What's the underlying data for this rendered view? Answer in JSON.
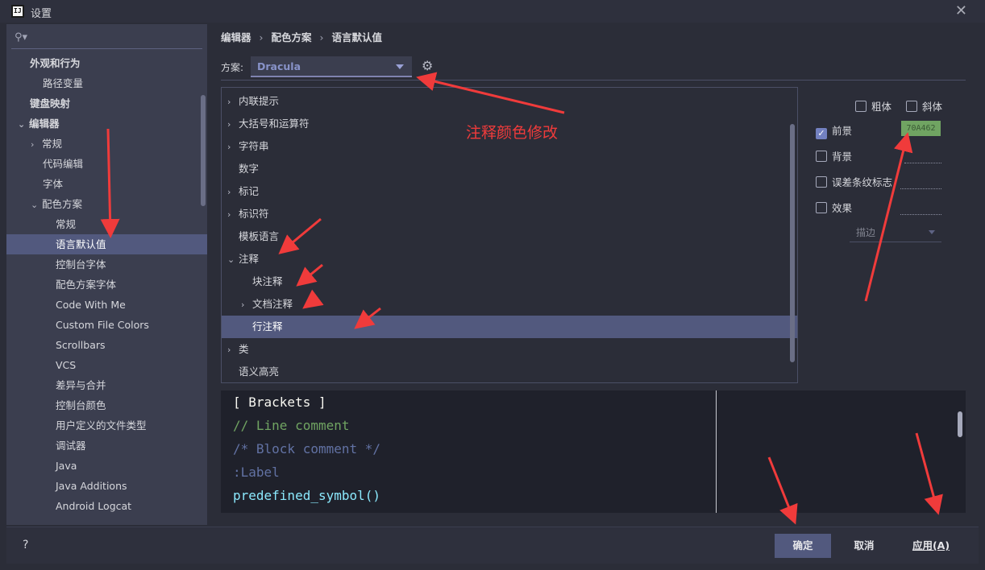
{
  "window": {
    "title": "设置",
    "app_icon": "IJ",
    "close_icon": "close-icon"
  },
  "sidebar": {
    "search_placeholder": "",
    "items": [
      {
        "label": "外观和行为",
        "level": 0,
        "bold": true
      },
      {
        "label": "路径变量",
        "level": 1
      },
      {
        "label": "键盘映射",
        "level": 0,
        "bold": true
      },
      {
        "label": "编辑器",
        "level": 0,
        "bold": true,
        "expanded": true
      },
      {
        "label": "常规",
        "level": 1,
        "collapsed": true
      },
      {
        "label": "代码编辑",
        "level": 1
      },
      {
        "label": "字体",
        "level": 1
      },
      {
        "label": "配色方案",
        "level": 1,
        "expanded": true
      },
      {
        "label": "常规",
        "level": 2
      },
      {
        "label": "语言默认值",
        "level": 2,
        "selected": true
      },
      {
        "label": "控制台字体",
        "level": 2
      },
      {
        "label": "配色方案字体",
        "level": 2
      },
      {
        "label": "Code With Me",
        "level": 2
      },
      {
        "label": "Custom File Colors",
        "level": 2
      },
      {
        "label": "Scrollbars",
        "level": 2
      },
      {
        "label": "VCS",
        "level": 2
      },
      {
        "label": "差异与合并",
        "level": 2
      },
      {
        "label": "控制台颜色",
        "level": 2
      },
      {
        "label": "用户定义的文件类型",
        "level": 2
      },
      {
        "label": "调试器",
        "level": 2
      },
      {
        "label": "Java",
        "level": 2
      },
      {
        "label": "Java Additions",
        "level": 2
      },
      {
        "label": "Android Logcat",
        "level": 2
      }
    ]
  },
  "breadcrumb": [
    "编辑器",
    "配色方案",
    "语言默认值"
  ],
  "scheme": {
    "label": "方案:",
    "value": "Dracula"
  },
  "attributes": [
    {
      "label": "内联提示",
      "chevron": true,
      "indent": 0
    },
    {
      "label": "大括号和运算符",
      "chevron": true,
      "indent": 0
    },
    {
      "label": "字符串",
      "chevron": true,
      "indent": 0
    },
    {
      "label": "数字",
      "chevron": false,
      "indent": 0
    },
    {
      "label": "标记",
      "chevron": true,
      "indent": 0
    },
    {
      "label": "标识符",
      "chevron": true,
      "indent": 0
    },
    {
      "label": "模板语言",
      "chevron": false,
      "indent": 0
    },
    {
      "label": "注释",
      "chevron": true,
      "expanded": true,
      "indent": 0
    },
    {
      "label": "块注释",
      "chevron": false,
      "indent": 1
    },
    {
      "label": "文档注释",
      "chevron": true,
      "indent": 1
    },
    {
      "label": "行注释",
      "chevron": false,
      "indent": 1,
      "selected": true
    },
    {
      "label": "类",
      "chevron": true,
      "indent": 0
    },
    {
      "label": "语义高亮",
      "chevron": false,
      "indent": 0
    }
  ],
  "annotation_text": "注释颜色修改",
  "options": {
    "bold": {
      "label": "粗体",
      "checked": false
    },
    "italic": {
      "label": "斜体",
      "checked": false
    },
    "foreground": {
      "label": "前景",
      "checked": true,
      "value": "70A462",
      "color": "#70a462"
    },
    "background": {
      "label": "背景",
      "checked": false
    },
    "error_stripe": {
      "label": "误差条纹标志",
      "checked": false
    },
    "effects": {
      "label": "效果",
      "checked": false
    },
    "effect_type": "描边"
  },
  "preview": [
    {
      "text": "[ Brackets ]",
      "color": "#f8f8f2"
    },
    {
      "text": "// Line comment",
      "color": "#70a462"
    },
    {
      "text": "/* Block comment */",
      "color": "#6272a4"
    },
    {
      "text": ":Label",
      "color": "#6272a4"
    },
    {
      "text": "predefined_symbol()",
      "color": "#8be9fd"
    }
  ],
  "buttons": {
    "help": "?",
    "ok": "确定",
    "cancel": "取消",
    "apply": "应用(A)"
  },
  "accent_color": "#52597e",
  "arrow_color": "#f03b3b"
}
